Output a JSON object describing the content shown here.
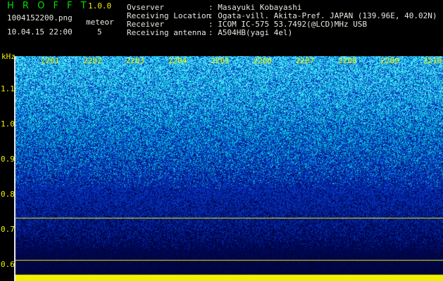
{
  "header": {
    "app_name": "H R O F F T",
    "version": "1.0.0",
    "filename": "1004152200.png",
    "datetime": "10.04.15 22:00",
    "meteor_label": "meteor",
    "meteor_count": "5"
  },
  "info": {
    "observer_key": "Ovserver",
    "observer_value": ": Masayuki Kobayashi",
    "location_key": "Receiving Location",
    "location_value": ": Ogata-vill. Akita-Pref. JAPAN (139.96E, 40.02N)",
    "receiver_key": "Receiver",
    "receiver_value": ": ICOM IC-575 53.7492(@LCD)MHz USB",
    "antenna_key": "Receiving antenna",
    "antenna_value": ": A504HB(yagi 4el)"
  },
  "chart_data": {
    "type": "heatmap",
    "ylabel": "kHz",
    "y_ticks": [
      "1.1",
      "1.0",
      "0.9",
      "0.8",
      "0.7",
      "0.6"
    ],
    "time_labels": [
      "2201",
      "2202",
      "2203",
      "2204",
      "2205",
      "2206",
      "2207",
      "2208",
      "2209",
      "2210"
    ],
    "colors": {
      "background": "#000000",
      "label": "#f0f000",
      "signal_low": "#0a1a80",
      "signal_high": "#20e0ff",
      "marker": "#f0f000"
    }
  }
}
